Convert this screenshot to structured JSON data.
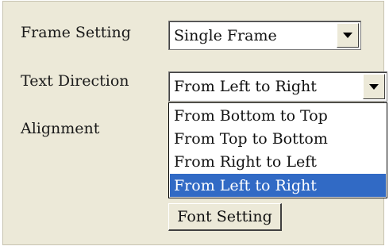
{
  "frame_setting": {
    "label": "Frame Setting",
    "value": "Single Frame"
  },
  "text_direction": {
    "label": "Text Direction",
    "value": "From Left to Right",
    "options": [
      "From Bottom to Top",
      "From Top to Bottom",
      "From Right to Left",
      "From Left to Right"
    ],
    "selected_option": "From Left to Right"
  },
  "alignment": {
    "label": "Alignment"
  },
  "font_setting": {
    "label": "Font Setting"
  },
  "colors": {
    "panel_background": "#ece9d8",
    "selection_highlight": "#316ac5"
  },
  "icons": {
    "dropdown_arrow": "chevron-down-icon"
  }
}
